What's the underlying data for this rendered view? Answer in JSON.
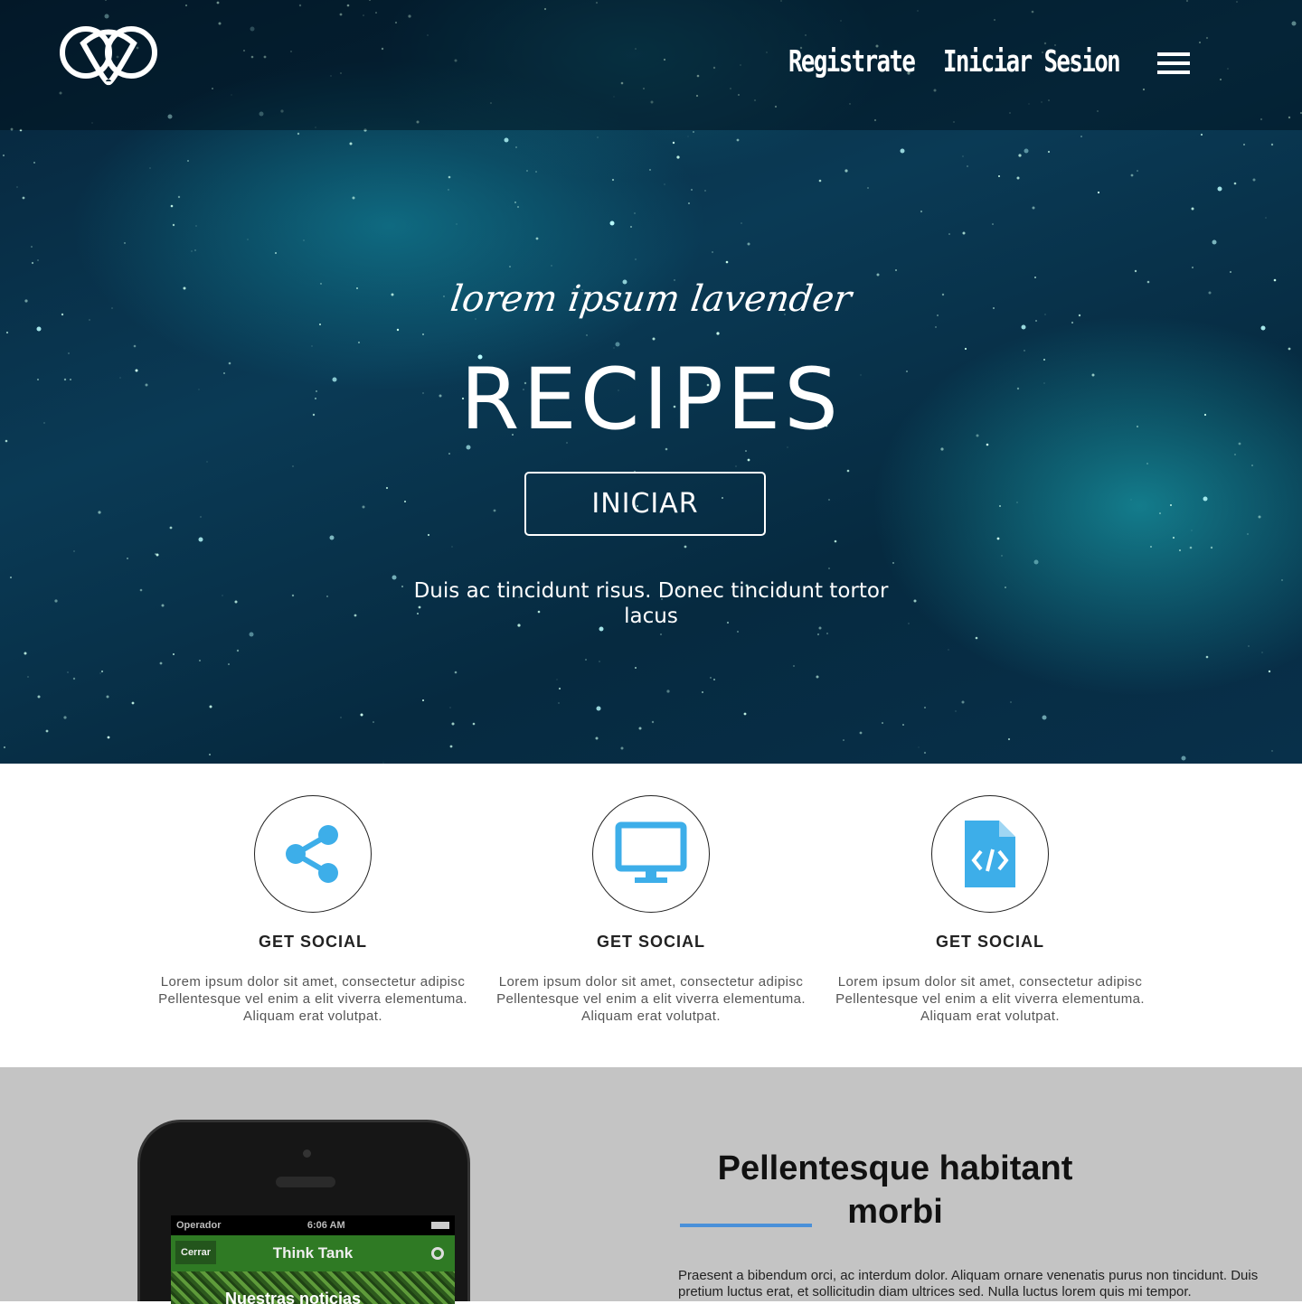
{
  "nav": {
    "register": "Registrate",
    "login": "Iniciar Sesion"
  },
  "hero": {
    "script": "lorem ipsum lavender",
    "title": "RECIPES",
    "button": "INICIAR",
    "subtitle": "Duis ac tincidunt risus. Donec tincidunt tortor lacus"
  },
  "features": [
    {
      "icon": "share-icon",
      "title": "GET SOCIAL",
      "text": "Lorem ipsum dolor sit amet, consectetur adipisc Pellentesque vel enim a elit viverra elementuma. Aliquam erat volutpat."
    },
    {
      "icon": "monitor-icon",
      "title": "GET SOCIAL",
      "text": "Lorem ipsum dolor sit amet, consectetur adipisc Pellentesque vel enim a elit viverra elementuma. Aliquam erat volutpat."
    },
    {
      "icon": "code-file-icon",
      "title": "GET SOCIAL",
      "text": "Lorem ipsum dolor sit amet, consectetur adipisc Pellentesque vel enim a elit viverra elementuma. Aliquam erat volutpat."
    }
  ],
  "phone": {
    "carrier": "Operador",
    "time": "6:06 AM",
    "back": "Cerrar",
    "app_title": "Think Tank",
    "item": "Nuestras noticias"
  },
  "section": {
    "title": "Pellentesque habitant morbi",
    "text": "Praesent a bibendum orci, ac interdum dolor. Aliquam ornare venenatis purus non tincidunt. Duis pretium luctus erat, et sollicitudin diam ultrices sed. Nulla luctus lorem quis mi tempor."
  },
  "colors": {
    "accent": "#3daee9",
    "line": "#4a90d9"
  }
}
